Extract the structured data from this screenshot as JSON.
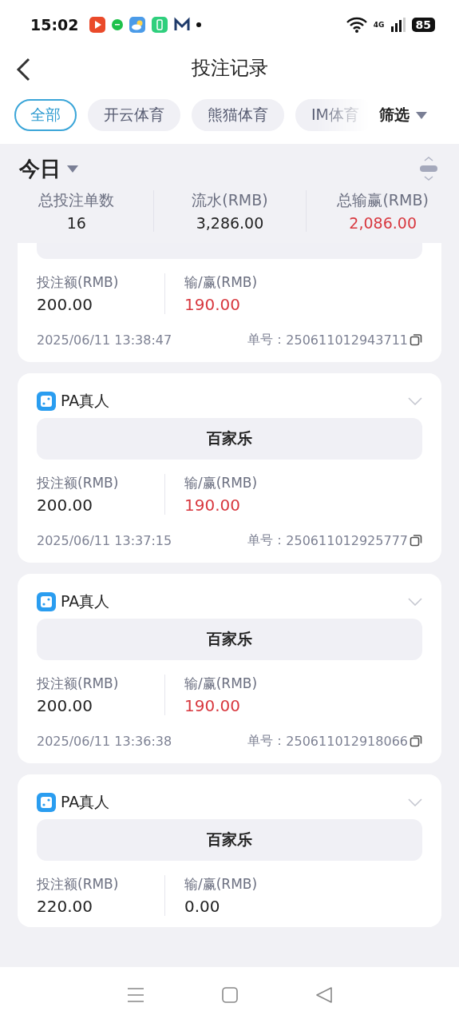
{
  "status_bar": {
    "time": "15:02",
    "battery": "85",
    "network": "4G"
  },
  "header": {
    "title": "投注记录"
  },
  "tabs": [
    {
      "label": "全部",
      "selected": true
    },
    {
      "label": "开云体育",
      "selected": false
    },
    {
      "label": "熊猫体育",
      "selected": false
    },
    {
      "label": "IM体育",
      "selected": false
    }
  ],
  "filter": {
    "label": "筛选"
  },
  "period": {
    "label": "今日"
  },
  "summary": [
    {
      "label": "总投注单数",
      "value": "16",
      "highlight": false
    },
    {
      "label": "流水(RMB)",
      "value": "3,286.00",
      "highlight": false
    },
    {
      "label": "总输赢(RMB)",
      "value": "2,086.00",
      "highlight": true
    }
  ],
  "records": [
    {
      "kind": "partial",
      "stake_label": "投注额(RMB)",
      "stake": "200.00",
      "result_label": "输/赢(RMB)",
      "result": "190.00",
      "highlight": true,
      "time": "2025/06/11 13:38:47",
      "order_label": "单号：",
      "order_no": "250611012943711"
    },
    {
      "kind": "full",
      "venue": "PA真人",
      "game": "百家乐",
      "stake_label": "投注额(RMB)",
      "stake": "200.00",
      "result_label": "输/赢(RMB)",
      "result": "190.00",
      "highlight": true,
      "time": "2025/06/11 13:37:15",
      "order_label": "单号：",
      "order_no": "250611012925777"
    },
    {
      "kind": "full",
      "venue": "PA真人",
      "game": "百家乐",
      "stake_label": "投注额(RMB)",
      "stake": "200.00",
      "result_label": "输/赢(RMB)",
      "result": "190.00",
      "highlight": true,
      "time": "2025/06/11 13:36:38",
      "order_label": "单号：",
      "order_no": "250611012918066"
    },
    {
      "kind": "full",
      "venue": "PA真人",
      "game": "百家乐",
      "stake_label": "投注额(RMB)",
      "stake": "220.00",
      "result_label": "输/赢(RMB)",
      "result": "0.00",
      "highlight": false
    }
  ]
}
